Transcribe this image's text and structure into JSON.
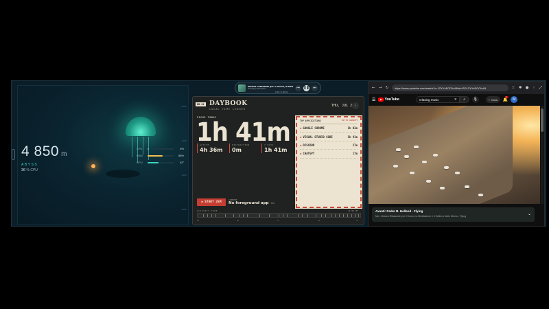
{
  "mini_player": {
    "title": "Musica Rilassante per il Sonno, la Medi...",
    "artist": "Soothing Relaxation",
    "time": "0:58 / 4:00:52",
    "prev_icon": "skip-back-icon",
    "play_icon": "pause-icon",
    "next_icon": "skip-forward-icon"
  },
  "abyss": {
    "depth": "4 850",
    "unit": "m",
    "label": "ABYSS",
    "cpu_value": "36",
    "cpu_unit": "%",
    "cpu_label": "CPU",
    "metrics": [
      {
        "name": "CPU",
        "value": "5%",
        "level": 0.05,
        "color": "#3fd4c3"
      },
      {
        "name": "RAM",
        "value": "58%",
        "level": 0.58,
        "color": "#f2c14e"
      },
      {
        "name": "GPU",
        "value": "42°",
        "level": 0.42,
        "color": "#3fd4c3"
      }
    ],
    "edge_ticks": [
      "-1000",
      "-2000",
      "-3000",
      "-4000"
    ]
  },
  "daybook": {
    "tag": "DB·01",
    "title": "DAYBOOK",
    "subtitle": "LOCAL TIME LEDGER",
    "date": "THU, JUL 23",
    "focus_label": "FOCUS TODAY",
    "focus_value": "1h 41m",
    "stats": [
      {
        "label": "ACTIVE",
        "value": "4h 36m"
      },
      {
        "label": "DISTRACTION",
        "value": "0m"
      },
      {
        "label": "7 DAYS",
        "value": "1h 41m"
      }
    ],
    "apps_header": "TOP APPLICATIONS",
    "apps_header_right": "TAP TO CLASSIFY",
    "apps": [
      {
        "name": "GOOGLE CHROME",
        "time": "1h 03m"
      },
      {
        "name": "VISUAL STUDIO CODE",
        "time": "1h 41m"
      },
      {
        "name": "DISCORD",
        "time": "27m"
      },
      {
        "name": "CHATGPT",
        "time": "17m"
      }
    ],
    "start_button": "START 25M",
    "current_label": "CURRENT",
    "current_value": "No foreground app",
    "current_time": "0m",
    "tape_label": "ACTIVITY TAPE",
    "tape_time": "11:04 PM",
    "tape_axis": [
      "00",
      "06",
      "12",
      "18",
      "24"
    ]
  },
  "browser": {
    "url": "https://www.youtube.com/watch?v=1ZYXzEOOIv4&list=RD1ZYXzEOOIv4&",
    "toolbar_icons": [
      "back-icon",
      "forward-icon",
      "reload-icon"
    ],
    "right_icons": [
      "star-icon",
      "extensions-icon",
      "profile-icon",
      "menu-icon",
      "fullscreen-icon"
    ],
    "yt": {
      "logo": "YouTube",
      "search_value": "relaxing music",
      "create_label": "Crea",
      "bell_badge": "9+",
      "avatar": "M",
      "next_title": "Avanti: Peder B. Helland - Flying",
      "next_sub": "Mix - Musica Rilassante per il Sonno, la Meditazione e il Sollievo Dallo Stress • Flying"
    }
  }
}
